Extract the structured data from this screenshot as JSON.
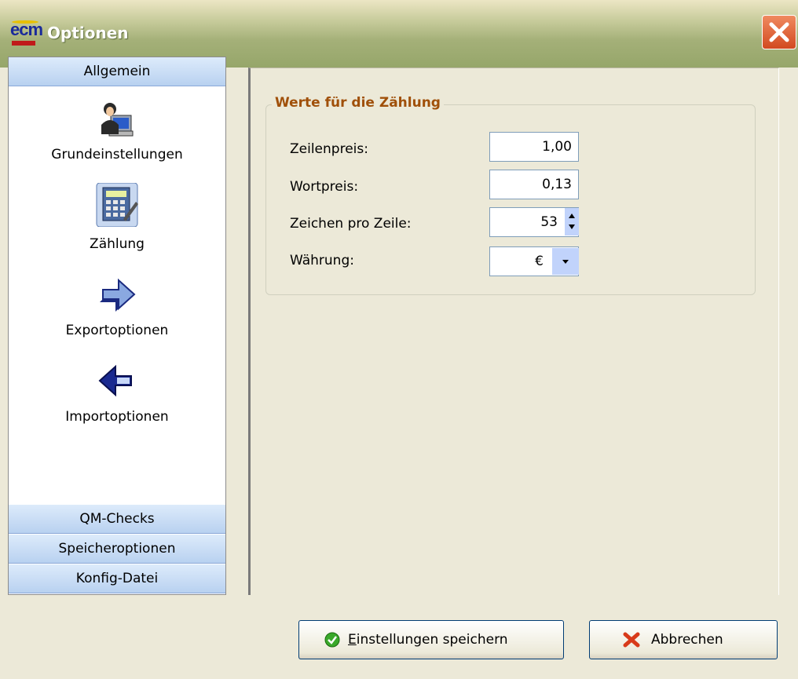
{
  "window": {
    "title": "Optionen",
    "logo_text": "ecm"
  },
  "nav": {
    "headers": {
      "allgemein": "Allgemein",
      "qm_checks": "QM-Checks",
      "speicheroptionen": "Speicheroptionen",
      "konfig_datei": "Konfig-Datei"
    },
    "items": [
      {
        "label": "Grundeinstellungen",
        "icon": "user-computer-icon"
      },
      {
        "label": "Zählung",
        "icon": "calculator-icon"
      },
      {
        "label": "Exportoptionen",
        "icon": "arrow-right-icon"
      },
      {
        "label": "Importoptionen",
        "icon": "arrow-left-icon"
      }
    ]
  },
  "group": {
    "title": "Werte für die Zählung",
    "fields": {
      "zeilenpreis": {
        "label": "Zeilenpreis:",
        "value": "1,00"
      },
      "wortpreis": {
        "label": "Wortpreis:",
        "value": "0,13"
      },
      "zeichen_pro_zeile": {
        "label": "Zeichen pro Zeile:",
        "value": "53"
      },
      "waehrung": {
        "label": "Währung:",
        "value": "€"
      }
    }
  },
  "buttons": {
    "save": {
      "prefix": "E",
      "rest": "instellungen speichern"
    },
    "cancel": {
      "label": "Abbrechen"
    }
  },
  "colors": {
    "group_title": "#a0500a",
    "nav_header": "#c4d8f2",
    "close_button": "#e05a2a",
    "titlebar": "#a4b078"
  }
}
